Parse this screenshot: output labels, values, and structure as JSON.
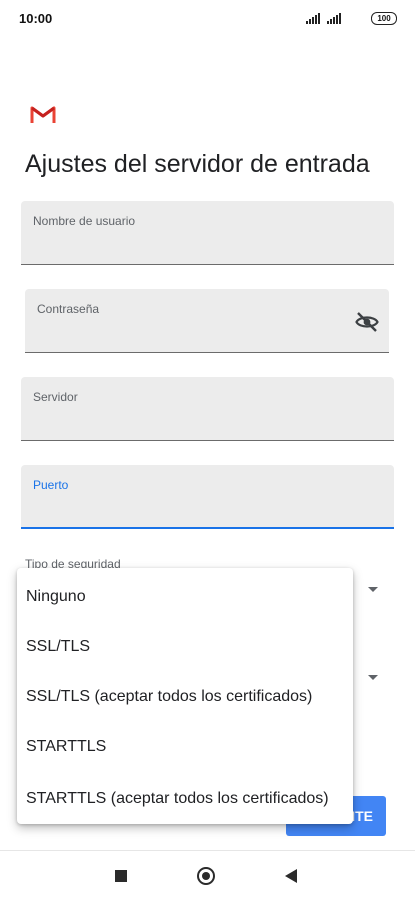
{
  "status_bar": {
    "time": "10:00",
    "battery": "100"
  },
  "page_title": "Ajustes del servidor de entrada",
  "fields": {
    "username_label": "Nombre de usuario",
    "password_label": "Contraseña",
    "server_label": "Servidor",
    "port_label": "Puerto"
  },
  "security": {
    "label": "Tipo de seguridad"
  },
  "next_button": {
    "label": "SIGUIENTE"
  },
  "dropdown": {
    "options": [
      "Ninguno",
      "SSL/TLS",
      "SSL/TLS (aceptar todos los certificados)",
      "STARTTLS",
      "STARTTLS (aceptar todos los certificados)"
    ]
  },
  "colors": {
    "accent": "#1a73e8",
    "gmail_red": "#ea4335",
    "button": "#4285f4"
  }
}
